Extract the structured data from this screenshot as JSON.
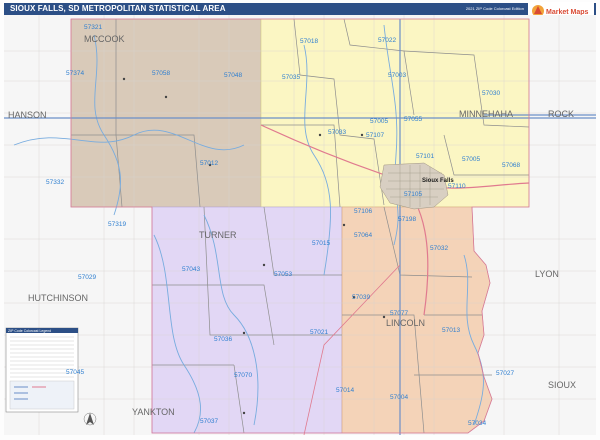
{
  "header": {
    "title": "SIOUX FALLS, SD METROPOLITAN STATISTICAL AREA",
    "edition": "2021 ZIP Code Colorcast Edition",
    "logo_text": "Market Maps"
  },
  "colors": {
    "title_bar": "#2c4f86",
    "mccook": "#d8c9b8",
    "minnehaha": "#fbf6c2",
    "turner": "#e1d6f4",
    "lincoln": "#f4d3b8",
    "outside": "#f7f7f7",
    "zip_label": "#2f7fd0",
    "county_label": "#5a5a5a",
    "river": "#6fa7dc",
    "highway": "#6f93c9"
  },
  "counties": [
    {
      "id": "mccook",
      "label": "MCCOOK"
    },
    {
      "id": "minnehaha",
      "label": "MINNEHAHA"
    },
    {
      "id": "turner",
      "label": "TURNER"
    },
    {
      "id": "lincoln",
      "label": "LINCOLN"
    },
    {
      "id": "hanson",
      "label": "HANSON"
    },
    {
      "id": "rock",
      "label": "ROCK"
    },
    {
      "id": "hutchinson",
      "label": "HUTCHINSON"
    },
    {
      "id": "lyon",
      "label": "LYON"
    },
    {
      "id": "yankton",
      "label": "YANKTON"
    },
    {
      "id": "sioux",
      "label": "SIOUX"
    }
  ],
  "city": {
    "label": "Sioux Falls"
  },
  "zips": [
    "57321",
    "57018",
    "57022",
    "57374",
    "57058",
    "57048",
    "57035",
    "57003",
    "57030",
    "57033",
    "57107",
    "57005",
    "57055",
    "57012",
    "57332",
    "57101",
    "57105",
    "57068",
    "57110",
    "57106",
    "57198",
    "57319",
    "57015",
    "57064",
    "57032",
    "57029",
    "57043",
    "57053",
    "57039",
    "57077",
    "57021",
    "57036",
    "57013",
    "57045",
    "57070",
    "57014",
    "57004",
    "57027",
    "57037",
    "57034"
  ],
  "legend": {
    "title": "ZIP Code Colorcast Legend"
  }
}
